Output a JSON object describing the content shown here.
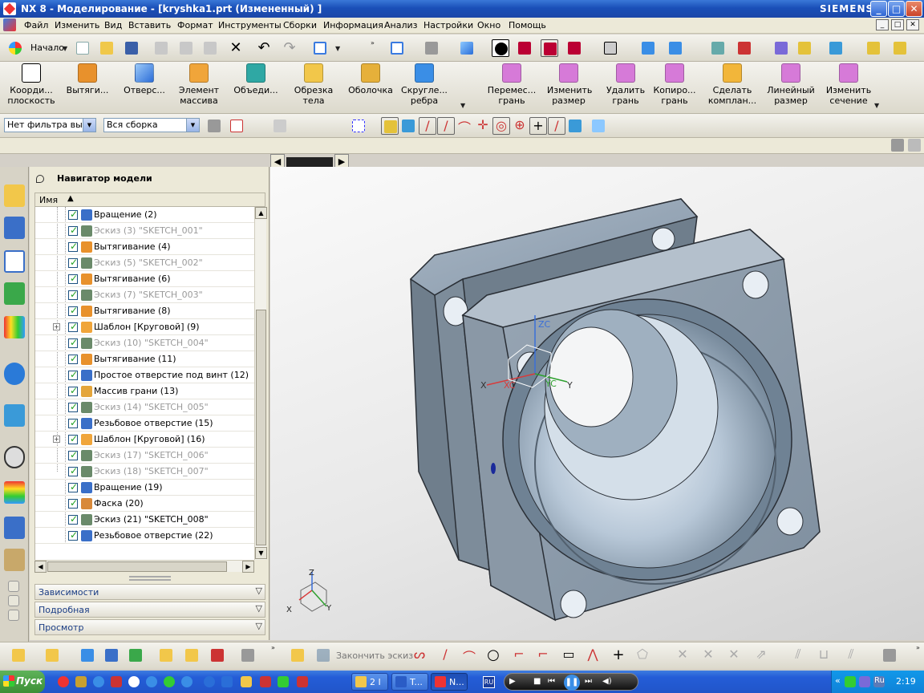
{
  "window": {
    "title": "NX 8 - Моделирование - [kryshka1.prt (Измененный) ]",
    "brand": "SIEMENS"
  },
  "menu": [
    "Файл",
    "Изменить",
    "Вид",
    "Вставить",
    "Формат",
    "Инструменты",
    "Сборки",
    "Информация",
    "Анализ",
    "Настройки",
    "Окно",
    "Помощь"
  ],
  "toolbar1": {
    "start_label": "Начало"
  },
  "features": [
    {
      "label": "Коорди...\nплоскость",
      "icon": "datum-plane-icon"
    },
    {
      "label": "Вытяги...",
      "icon": "extrude-icon"
    },
    {
      "label": "Отверс...",
      "icon": "hole-icon"
    },
    {
      "label": "Элемент\nмассива",
      "icon": "pattern-icon"
    },
    {
      "label": "Объеди...",
      "icon": "unite-icon"
    },
    {
      "label": "Обрезка\nтела",
      "icon": "trim-body-icon"
    },
    {
      "label": "Оболочка",
      "icon": "shell-icon"
    },
    {
      "label": "Скругле...\nребра",
      "icon": "edge-blend-icon"
    }
  ],
  "sync": [
    {
      "label": "Перемес...\nгрань",
      "icon": "move-face-icon"
    },
    {
      "label": "Изменить\nразмер",
      "icon": "resize-face-icon"
    },
    {
      "label": "Удалить\nгрань",
      "icon": "delete-face-icon"
    },
    {
      "label": "Копиро...\nгрань",
      "icon": "copy-face-icon"
    },
    {
      "label": "Сделать\nкомплан...",
      "icon": "make-coplanar-icon"
    },
    {
      "label": "Линейный\nразмер",
      "icon": "linear-dimension-icon"
    },
    {
      "label": "Изменить\nсечение",
      "icon": "edit-section-icon"
    }
  ],
  "selection": {
    "filter": "Нет фильтра выбо",
    "scope": "Вся сборка"
  },
  "navigator": {
    "title": "Навигатор модели",
    "column": "Имя",
    "items": [
      {
        "label": "Вращение (2)",
        "dim": false,
        "icon": "revolve-icon"
      },
      {
        "label": "Эскиз (3) \"SKETCH_001\"",
        "dim": true,
        "icon": "sketch-icon"
      },
      {
        "label": "Вытягивание (4)",
        "dim": false,
        "icon": "extrude-icon"
      },
      {
        "label": "Эскиз (5) \"SKETCH_002\"",
        "dim": true,
        "icon": "sketch-icon"
      },
      {
        "label": "Вытягивание (6)",
        "dim": false,
        "icon": "extrude-icon"
      },
      {
        "label": "Эскиз (7) \"SKETCH_003\"",
        "dim": true,
        "icon": "sketch-icon"
      },
      {
        "label": "Вытягивание (8)",
        "dim": false,
        "icon": "extrude-icon"
      },
      {
        "label": "Шаблон [Круговой] (9)",
        "dim": false,
        "icon": "circular-pattern-icon",
        "expand": true
      },
      {
        "label": "Эскиз (10) \"SKETCH_004\"",
        "dim": true,
        "icon": "sketch-icon"
      },
      {
        "label": "Вытягивание (11)",
        "dim": false,
        "icon": "extrude-icon"
      },
      {
        "label": "Простое отверстие под винт (12)",
        "dim": false,
        "icon": "simple-hole-icon"
      },
      {
        "label": "Массив грани (13)",
        "dim": false,
        "icon": "face-pattern-icon"
      },
      {
        "label": "Эскиз (14) \"SKETCH_005\"",
        "dim": true,
        "icon": "sketch-icon"
      },
      {
        "label": "Резьбовое отверстие (15)",
        "dim": false,
        "icon": "threaded-hole-icon"
      },
      {
        "label": "Шаблон [Круговой] (16)",
        "dim": false,
        "icon": "circular-pattern-icon",
        "expand": true
      },
      {
        "label": "Эскиз (17) \"SKETCH_006\"",
        "dim": true,
        "icon": "sketch-icon"
      },
      {
        "label": "Эскиз (18) \"SKETCH_007\"",
        "dim": true,
        "icon": "sketch-icon"
      },
      {
        "label": "Вращение (19)",
        "dim": false,
        "icon": "revolve-icon"
      },
      {
        "label": "Фаска (20)",
        "dim": false,
        "icon": "chamfer-icon"
      },
      {
        "label": "Эскиз (21) \"SKETCH_008\"",
        "dim": false,
        "icon": "sketch-icon"
      },
      {
        "label": "Резьбовое отверстие (22)",
        "dim": false,
        "icon": "threaded-hole-icon"
      }
    ],
    "panels": [
      "Зависимости",
      "Подробная",
      "Просмотр"
    ]
  },
  "viewport": {
    "wcs": {
      "x": "X",
      "xc": "XC",
      "yc": "YC",
      "y": "Y",
      "zc": "ZC"
    },
    "triad": {
      "x": "X",
      "y": "Y",
      "z": "Z"
    }
  },
  "bottom": {
    "finish_sketch": "Закончить эскиз"
  },
  "taskbar": {
    "start": "Пуск",
    "tasks": [
      "2 I",
      "T...",
      "N..."
    ],
    "lang": "RU",
    "lang_tray": "Ru",
    "clock": "2:19"
  }
}
